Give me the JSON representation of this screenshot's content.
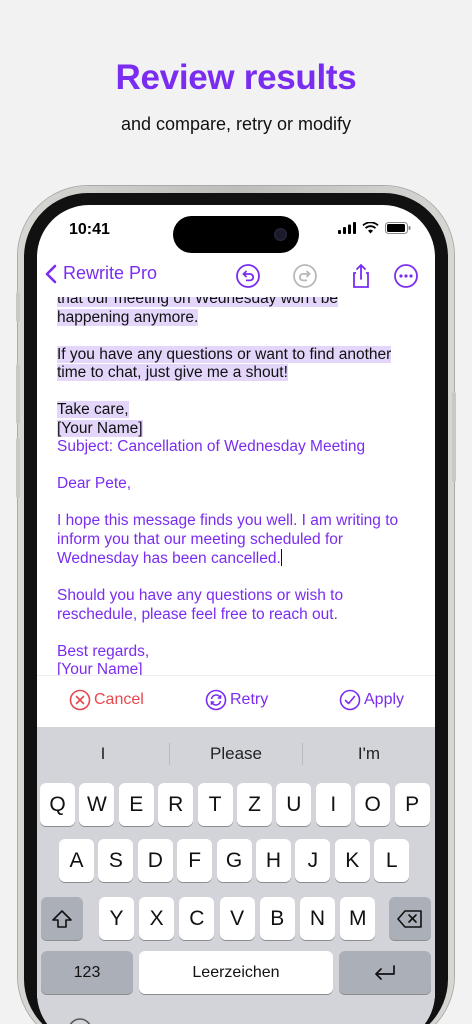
{
  "promo": {
    "headline": "Review results",
    "subline": "and compare, retry or modify"
  },
  "status": {
    "time": "10:41"
  },
  "nav": {
    "back_label": "Rewrite Pro",
    "icons": [
      "undo-icon",
      "redo-icon",
      "share-icon",
      "more-icon"
    ]
  },
  "editor": {
    "original": {
      "partial_line": "that our meeting on Wednesday won't be",
      "line2": "happening anymore.",
      "para2_l1": "If you have any questions or want to find another",
      "para2_l2": "time to chat, just give me a shout!",
      "signoff": "Take care,",
      "name": "[Your Name]"
    },
    "rewritten": {
      "subject": "Subject: Cancellation of Wednesday Meeting",
      "greeting": "Dear Pete,",
      "body_l1": "I hope this message finds you well. I am writing to",
      "body_l2": "inform you that our meeting scheduled for",
      "body_l3": "Wednesday has been cancelled.",
      "para2_l1": "Should you have any questions or wish to",
      "para2_l2": "reschedule, please feel free to reach out.",
      "signoff": "Best regards,",
      "name": "[Your Name]"
    }
  },
  "actions": {
    "cancel": "Cancel",
    "retry": "Retry",
    "apply": "Apply",
    "cancel_color": "#e5484d",
    "accent_color": "#7a2df0"
  },
  "keyboard": {
    "suggestions": [
      "I",
      "Please",
      "I'm"
    ],
    "row1": [
      "Q",
      "W",
      "E",
      "R",
      "T",
      "Z",
      "U",
      "I",
      "O",
      "P"
    ],
    "row2": [
      "A",
      "S",
      "D",
      "F",
      "G",
      "H",
      "J",
      "K",
      "L"
    ],
    "row3": [
      "Y",
      "X",
      "C",
      "V",
      "B",
      "N",
      "M"
    ],
    "numbers_key": "123",
    "space_key": "Leerzeichen"
  }
}
